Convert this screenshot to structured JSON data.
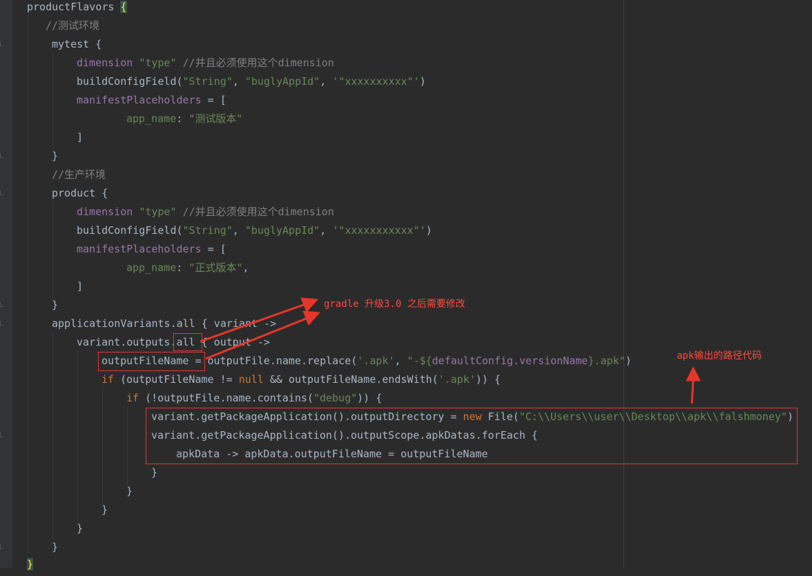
{
  "code": {
    "l1": {
      "t1": "productFlavors ",
      "brace": "{"
    },
    "l2": {
      "c": "//测试环境"
    },
    "l3": {
      "t1": "mytest {"
    },
    "l4": {
      "p": "dimension ",
      "s": "\"type\"",
      "c": " //并且必须使用这个dimension"
    },
    "l5": {
      "t1": "buildConfigField(",
      "s1": "\"String\"",
      "t2": ", ",
      "s2": "\"buglyAppId\"",
      "t3": ", ",
      "s3": "'\"xxxxxxxxxx\"'",
      "t4": ")"
    },
    "l6": {
      "p": "manifestPlaceholders",
      "t1": " = ["
    },
    "l7": {
      "p": "app_name",
      "t1": ": ",
      "s": "\"测试版本\""
    },
    "l8": {
      "t1": "]"
    },
    "l9": {
      "t1": "}"
    },
    "l10": {
      "c": "//生产环境"
    },
    "l11": {
      "t1": "product {"
    },
    "l12": {
      "p": "dimension ",
      "s": "\"type\"",
      "c": " //并且必须使用这个dimension"
    },
    "l13": {
      "t1": "buildConfigField(",
      "s1": "\"String\"",
      "t2": ", ",
      "s2": "\"buglyAppId\"",
      "t3": ", ",
      "s3": "'\"xxxxxxxxxxx\"'",
      "t4": ")"
    },
    "l14": {
      "p": "manifestPlaceholders",
      "t1": " = ["
    },
    "l15": {
      "p": "app_name",
      "t1": ": ",
      "s": "\"正式版本\"",
      "t2": ","
    },
    "l16": {
      "t1": "]"
    },
    "l17": {
      "t1": "}"
    },
    "l18": {
      "t1": "applicationVariants.all { variant ->"
    },
    "l19": {
      "t1": "variant.outputs.",
      "t2": "all",
      "t3": " { output ->"
    },
    "l20": {
      "t1": "outputFileName =",
      "t2": " outputFile.name.replace(",
      "s1": "'.apk'",
      "t3": ", ",
      "s2": "\"-${",
      "t4": "defaultConfig.versionName",
      "s3": "}.apk\"",
      "t5": ")"
    },
    "l21": {
      "k1": "if",
      "t1": " (outputFileName != ",
      "k2": "null",
      "t2": " && outputFileName.endsWith(",
      "s": "'.apk'",
      "t3": ")) {"
    },
    "l22": {
      "k": "if",
      "t1": " (!outputFile.name.contains(",
      "s": "\"debug\"",
      "t2": ")) {"
    },
    "l23": {
      "t1": "variant.getPackageApplication().outputDirectory = ",
      "k": "new",
      "t2": " File(",
      "s": "\"C:\\\\Users\\\\user\\\\Desktop\\\\apk\\\\falshmoney\"",
      "t3": ")"
    },
    "l24": {
      "t1": "variant.getPackageApplication().outputScope.apkDatas.forEach {"
    },
    "l25": {
      "t1": "apkData -> apkData.outputFileName = outputFileName"
    },
    "l26": {
      "t1": "}"
    },
    "l27": {
      "t1": "}"
    },
    "l28": {
      "t1": "}"
    },
    "l29": {
      "t1": "}"
    },
    "l30": {
      "t1": "}"
    },
    "l31": {
      "t1": "}"
    }
  },
  "annotations": {
    "gradle_note": "gradle 升级3.0 之后需要修改",
    "apk_note": "apk输出的路径代码"
  },
  "colors": {
    "background": "#2b2b2b",
    "keyword": "#cc7832",
    "string": "#6a8759",
    "comment": "#808080",
    "property": "#9876aa",
    "annotation": "#ff4a3d"
  }
}
